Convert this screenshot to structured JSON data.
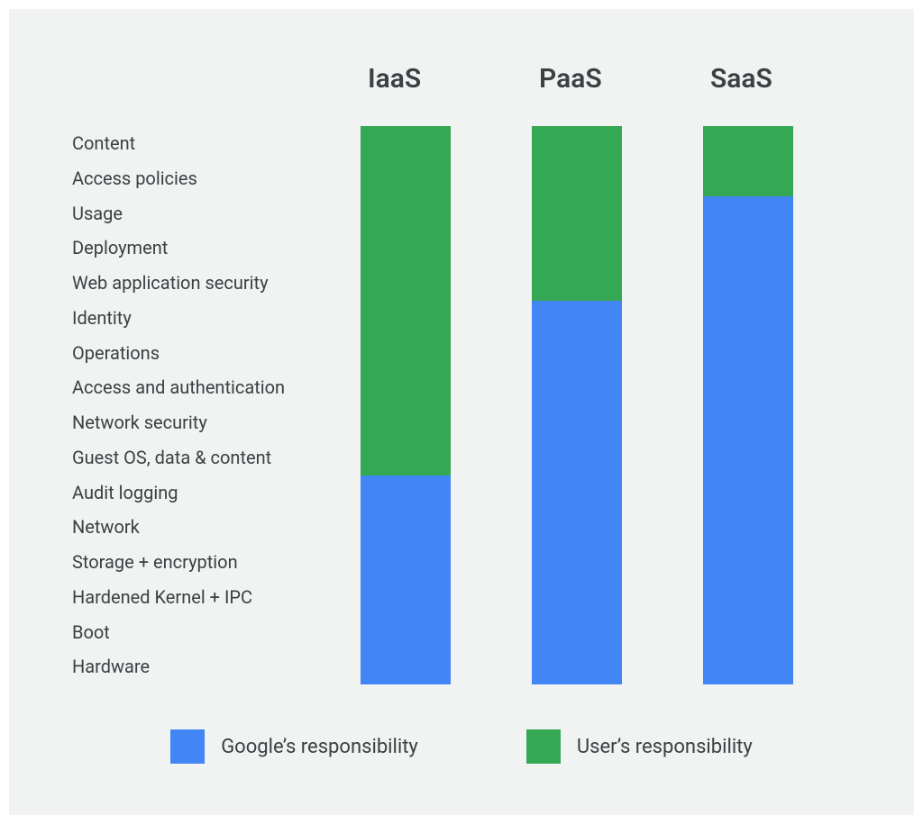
{
  "chart_data": {
    "type": "bar",
    "layers": [
      "Content",
      "Access policies",
      "Usage",
      "Deployment",
      "Web application security",
      "Identity",
      "Operations",
      "Access and authentication",
      "Network security",
      "Guest OS, data & content",
      "Audit logging",
      "Network",
      "Storage + encryption",
      "Hardened Kernel + IPC",
      "Boot",
      "Hardware"
    ],
    "series": [
      {
        "name": "IaaS",
        "user_layers": 10,
        "google_layers": 6
      },
      {
        "name": "PaaS",
        "user_layers": 5,
        "google_layers": 11
      },
      {
        "name": "SaaS",
        "user_layers": 2,
        "google_layers": 14
      }
    ],
    "legend": {
      "google": {
        "label": "Google’s responsibility",
        "color": "#4285f4"
      },
      "user": {
        "label": "User’s responsibility",
        "color": "#34a853"
      }
    },
    "total_layers": 16
  }
}
